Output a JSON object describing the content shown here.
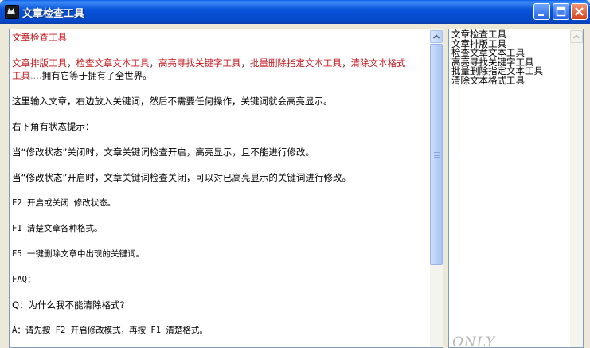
{
  "window": {
    "title": "文章检查工具"
  },
  "editor": {
    "heading": "文章检查工具",
    "keywords_line": {
      "items": [
        "文章排版工具",
        "检查文章文本工具",
        "高亮寻找关键字工具",
        "批量删除指定文本工具",
        "清除文本格式"
      ],
      "wrap_word": "工具",
      "dots": "....",
      "tail": "拥有它等于拥有了全世界。"
    },
    "paragraphs": [
      "这里输入文章，右边放入关键词，然后不需要任何操作，关键词就会高亮显示。",
      "右下角有状态提示：",
      "当“修改状态”关闭时，文章关键词检查开启，高亮显示，且不能进行修改。",
      "当“修改状态”开启时，文章关键词检查关闭，可以对已高亮显示的关键词进行修改。",
      "F2 开启或关闭 修改状态。",
      "F1 清楚文章各种格式。",
      "F5 一键删除文章中出现的关键词。",
      "FAQ：",
      "Q：为什么我不能清除格式?",
      "A：请先按 F2 开启修改模式，再按 F1 清楚格式。"
    ]
  },
  "keywords_panel": {
    "items": [
      "文章检查工具",
      "文章排版工具",
      "检查文章文本工具",
      "高亮寻找关键字工具",
      "批量删除指定文本工具",
      "清除文本格式工具"
    ],
    "watermark": "ONLY"
  },
  "colors": {
    "keyword": "#c4161c",
    "titlebar": "#0853d9"
  }
}
